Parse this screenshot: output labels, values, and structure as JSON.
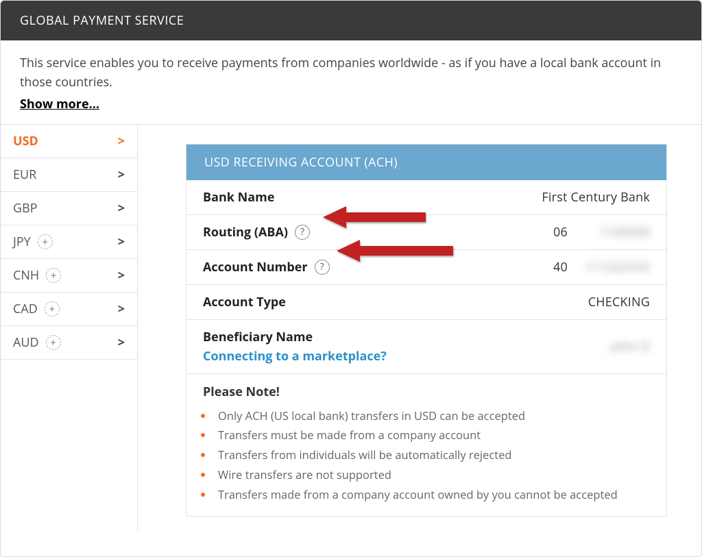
{
  "header": {
    "title": "GLOBAL PAYMENT SERVICE"
  },
  "intro": {
    "text": "This service enables you to receive payments from companies worldwide - as if you have a local bank account in those countries.",
    "show_more": "Show more..."
  },
  "currencies": [
    {
      "code": "USD",
      "add": false,
      "active": true
    },
    {
      "code": "EUR",
      "add": false,
      "active": false
    },
    {
      "code": "GBP",
      "add": false,
      "active": false
    },
    {
      "code": "JPY",
      "add": true,
      "active": false
    },
    {
      "code": "CNH",
      "add": true,
      "active": false
    },
    {
      "code": "CAD",
      "add": true,
      "active": false
    },
    {
      "code": "AUD",
      "add": true,
      "active": false
    }
  ],
  "panel": {
    "title": "USD RECEIVING ACCOUNT (ACH)",
    "rows": {
      "bank_name": {
        "label": "Bank Name",
        "value": "First Century Bank"
      },
      "routing": {
        "label": "Routing (ABA)",
        "value_prefix": "06",
        "value_hidden": "1100000"
      },
      "account_number": {
        "label": "Account Number",
        "value_prefix": "40",
        "value_hidden": "111222333"
      },
      "account_type": {
        "label": "Account Type",
        "value": "CHECKING"
      },
      "beneficiary": {
        "label": "Beneficiary Name",
        "sublink": "Connecting to a marketplace?",
        "value_hidden": "John D"
      }
    },
    "note": {
      "title": "Please Note!",
      "items": [
        "Only ACH (US local bank) transfers in USD can be accepted",
        "Transfers must be made from a company account",
        "Transfers from individuals will be automatically rejected",
        "Wire transfers are not supported",
        "Transfers made from a company account owned by you cannot be accepted"
      ]
    }
  },
  "glyphs": {
    "chev": ">",
    "plus": "+",
    "q": "?"
  }
}
